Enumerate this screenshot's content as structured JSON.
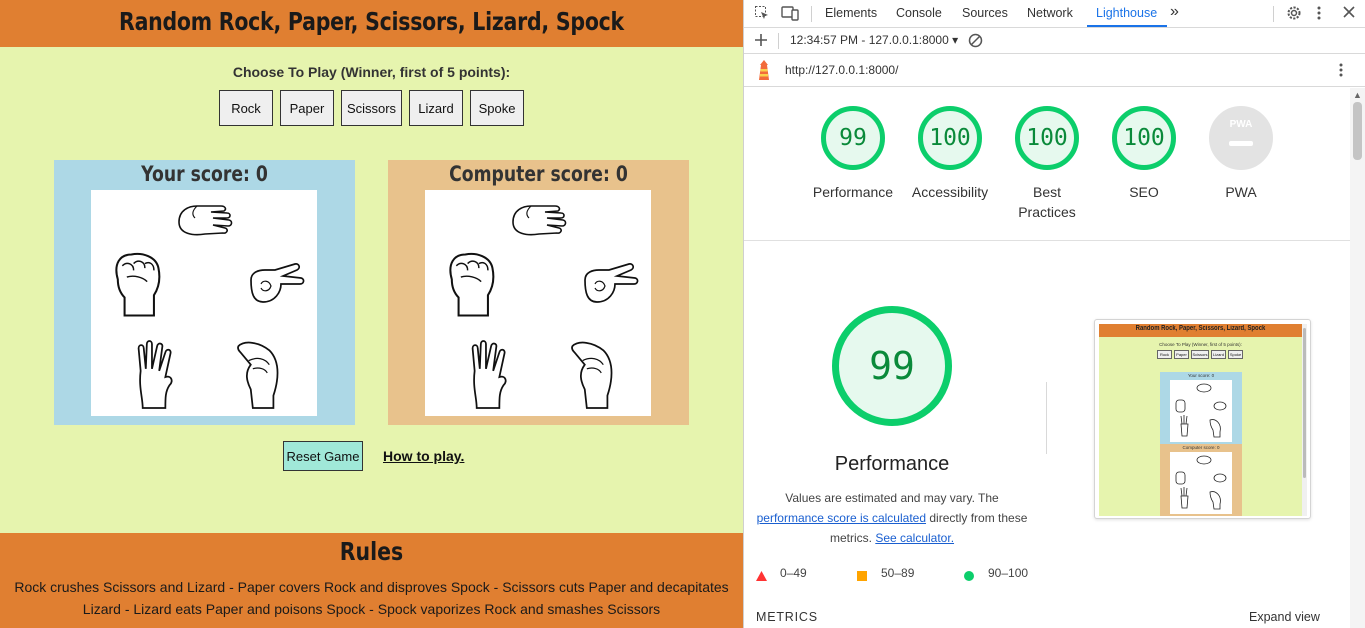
{
  "game": {
    "title": "Random Rock, Paper, Scissors, Lizard, Spock",
    "choose_label": "Choose To Play (Winner, first of 5 points):",
    "choices": [
      "Rock",
      "Paper",
      "Scissors",
      "Lizard",
      "Spoke"
    ],
    "player_score_label": "Your score: 0",
    "computer_score_label": "Computer score: 0",
    "reset_label": "Reset Game",
    "howto_label": "How to play.",
    "rules_title": "Rules",
    "rules_text": "Rock crushes Scissors and Lizard - Paper covers Rock and disproves Spock - Scissors cuts Paper and decapitates Lizard - Lizard eats Paper and poisons Spock - Spock vaporizes Rock and smashes Scissors",
    "hand_icons": [
      "paper-hand-icon",
      "rock-hand-icon",
      "scissors-hand-icon",
      "spock-hand-icon",
      "lizard-hand-icon"
    ],
    "colors": {
      "header": "#e07f31",
      "page": "#e6f4ae",
      "player_panel": "#add8e6",
      "computer_panel": "#e8c28c",
      "reset_button": "#a0e8d8"
    }
  },
  "devtools": {
    "tabs": [
      "Elements",
      "Console",
      "Sources",
      "Network",
      "Lighthouse"
    ],
    "active_tab": "Lighthouse",
    "more_tabs": "»",
    "report_select": "12:34:57 PM - 127.0.0.1:8000 ▾",
    "url": "http://127.0.0.1:8000/",
    "icons": [
      "inspect-icon",
      "device-toolbar-icon",
      "settings-icon",
      "more-options-icon",
      "close-icon",
      "add-icon",
      "clear-icon",
      "lighthouse-icon"
    ],
    "scores": [
      {
        "label": "Performance",
        "value": "99"
      },
      {
        "label": "Accessibility",
        "value": "100"
      },
      {
        "label": "Best Practices",
        "value": "100"
      },
      {
        "label": "SEO",
        "value": "100"
      },
      {
        "label": "PWA",
        "value": "",
        "badge": "PWA"
      }
    ],
    "performance": {
      "value": "99",
      "title": "Performance",
      "note_prefix": "Values are estimated and may vary. The",
      "note_link1": "performance score is calculated",
      "note_middle": "directly from these metrics.",
      "note_link2": "See calculator."
    },
    "legend": [
      {
        "symbol": "triangle",
        "range": "0–49",
        "color": "#ff3333"
      },
      {
        "symbol": "square",
        "range": "50–89",
        "color": "#ffa400"
      },
      {
        "symbol": "circle",
        "range": "90–100",
        "color": "#0cce6b"
      }
    ],
    "metrics_label": "METRICS",
    "expand_label": "Expand view",
    "thumbnail": {
      "title": "Random Rock, Paper, Scissors, Lizard, Spock",
      "choose": "Choose To Play (Winner, first of 5 points):",
      "choices": [
        "Rock",
        "Paper",
        "Scissors",
        "Lizard",
        "Spoke"
      ],
      "player_score": "Your score: 0",
      "computer_score": "Computer score: 0"
    }
  }
}
